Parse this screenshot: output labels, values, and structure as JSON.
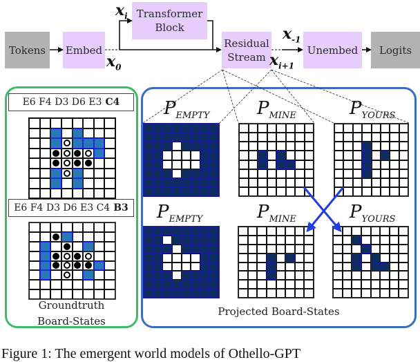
{
  "pipeline": {
    "tokens": "Tokens",
    "embed": "Embed",
    "transformer_block": [
      "Transformer",
      "Block"
    ],
    "residual_stream": [
      "Residual",
      "Stream"
    ],
    "unembed": "Unembed",
    "logits": "Logits",
    "labels": {
      "x_i": "x",
      "x_i_sub": "i",
      "x_0": "x",
      "x_0_sub": "0",
      "x_neg1": "x",
      "x_neg1_sub": "-1",
      "x_i1": "x",
      "x_i1_sub": "i+1"
    }
  },
  "groundtruth": {
    "boards": [
      {
        "moves_prefix": "E6 F4 D3 D6 E3",
        "moves_bold": "C4",
        "cells": [
          "........",
          "..B.B...",
          "..BWBBB.",
          "..KWKWB.",
          "..KWKK..",
          "..BWB...",
          "..B.B...",
          "........"
        ]
      },
      {
        "moves_prefix": "E6 F4 D3 D6 E3 C4",
        "moves_bold": "B3",
        "cells": [
          "........",
          "..KB....",
          ".B.K.B..",
          ".BKWKW..",
          ".BKWKKB.",
          ".B.W.B..",
          "........",
          "........"
        ]
      }
    ],
    "legend": {
      "K": "black disc",
      "W": "white disc",
      "B": "legal move (blue)"
    },
    "caption": [
      "Groundtruth",
      "Board-States"
    ]
  },
  "projected": {
    "probe_labels": [
      {
        "p": "P",
        "sub": "EMPTY"
      },
      {
        "p": "P",
        "sub": "MINE"
      },
      {
        "p": "P",
        "sub": "YOURS"
      }
    ],
    "rows": [
      [
        [
          "########",
          "########",
          "###.####",
          "##....##",
          "##....##",
          "###.####",
          "########",
          "########"
        ],
        [
          "........",
          "........",
          "........",
          "..#.#...",
          "..#.##..",
          "........",
          "........",
          "........"
        ],
        [
          "........",
          "........",
          "...#....",
          "...#.#..",
          "...#....",
          "...#....",
          "........",
          "........"
        ]
      ],
      [
        [
          "########",
          "##.#####",
          "###.####",
          "##....##",
          "##....##",
          "###.####",
          "########",
          "########"
        ],
        [
          "........",
          "........",
          "........",
          "...#.#..",
          "...#....",
          "...#....",
          "........",
          "........"
        ],
        [
          "........",
          "..#.....",
          "...#....",
          "..#.#...",
          "..#.##..",
          "........",
          "........",
          "........"
        ]
      ]
    ],
    "caption": "Projected Board-States"
  },
  "colors": {
    "gray_box": "#b3b3b3",
    "purple_box": "#e6cdfc",
    "green_panel": "#3dbb6b",
    "blue_panel": "#3a6cbf",
    "legal_blue": "#2b78b8",
    "probe_dark": "#0c2d5e",
    "swap_arrow": "#1f3de0"
  },
  "figure_caption": "Figure 1: The emergent world models of Othello-GPT"
}
